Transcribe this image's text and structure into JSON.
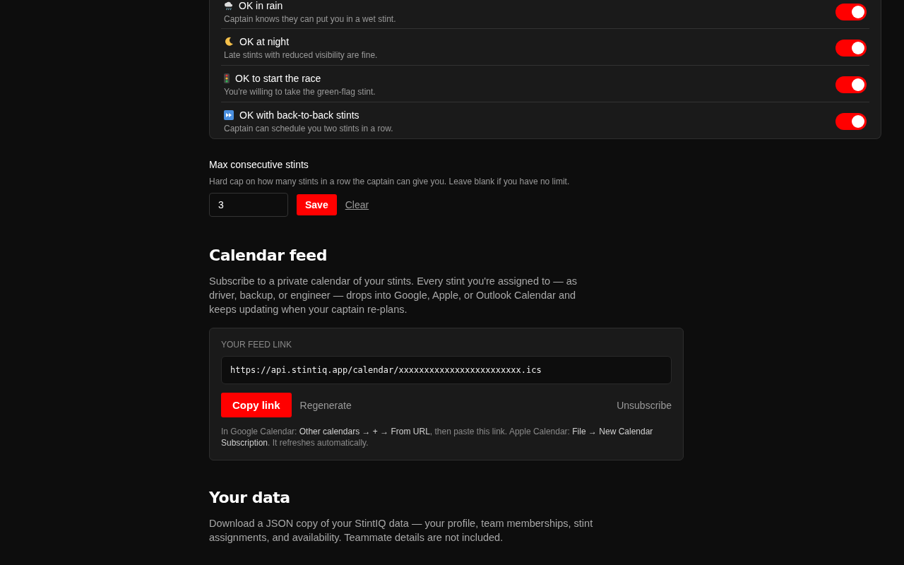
{
  "preferences": [
    {
      "label": "OK in rain",
      "description": "Captain knows they can put you in a wet stint.",
      "on": true
    },
    {
      "label": "OK at night",
      "description": "Late stints with reduced visibility are fine.",
      "on": true
    },
    {
      "label": "OK to start the race",
      "description": "You're willing to take the green-flag stint.",
      "on": true
    },
    {
      "label": "OK with back-to-back stints",
      "description": "Captain can schedule you two stints in a row.",
      "on": true
    }
  ],
  "max_stints": {
    "title": "Max consecutive stints",
    "hint": "Hard cap on how many stints in a row the captain can give you. Leave blank if you have no limit.",
    "value": "3",
    "save": "Save",
    "clear": "Clear"
  },
  "calendar": {
    "title": "Calendar feed",
    "description": "Subscribe to a private calendar of your stints. Every stint you're assigned to — as driver, backup, or engineer — drops into Google, Apple, or Outlook Calendar and keeps updating when your captain re-plans.",
    "feed_label": "YOUR FEED LINK",
    "url": "https://api.stintiq.app/calendar/xxxxxxxxxxxxxxxxxxxxxxxx.ics",
    "copy": "Copy link",
    "regenerate": "Regenerate",
    "unsubscribe": "Unsubscribe",
    "help": "In Google Calendar: **Other calendars → + → From URL**, then paste this link. Apple Calendar: **File → New Calendar Subscription**. It refreshes automatically."
  },
  "your_data": {
    "title": "Your data",
    "description": "Download a JSON copy of your StintIQ data — your profile, team memberships, stint assignments, and availability. Teammate details are not included."
  }
}
